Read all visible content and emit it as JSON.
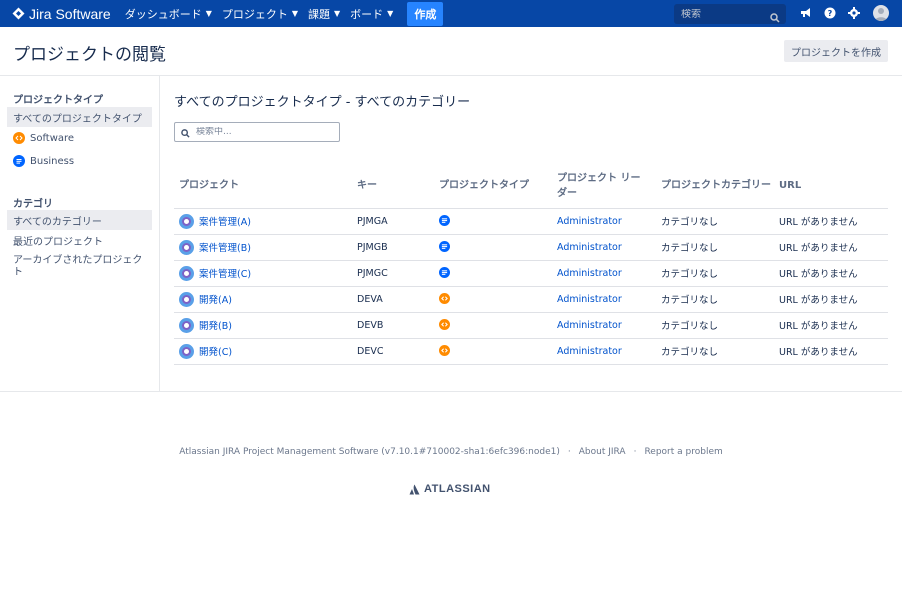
{
  "topnav": {
    "app_name": "Jira Software",
    "menu": [
      {
        "label": "ダッシュボード"
      },
      {
        "label": "プロジェクト"
      },
      {
        "label": "課題"
      },
      {
        "label": "ボード"
      }
    ],
    "create_label": "作成",
    "search_placeholder": "検索",
    "colors": {
      "nav_bg": "#0747a6",
      "create_bg": "#2684ff"
    }
  },
  "page": {
    "title": "プロジェクトの閲覧",
    "create_project_label": "プロジェクトを作成"
  },
  "sidebar": {
    "project_type_heading": "プロジェクトタイプ",
    "project_types": [
      {
        "label": "すべてのプロジェクトタイプ",
        "icon": "none",
        "selected": true
      },
      {
        "label": "Software",
        "icon": "software-icon",
        "selected": false
      },
      {
        "label": "Business",
        "icon": "business-icon",
        "selected": false
      }
    ],
    "category_heading": "カテゴリ",
    "categories": [
      {
        "label": "すべてのカテゴリー",
        "selected": true
      },
      {
        "label": "最近のプロジェクト",
        "selected": false
      },
      {
        "label": "アーカイブされたプロジェクト",
        "selected": false
      }
    ]
  },
  "main": {
    "heading": "すべてのプロジェクトタイプ - すべてのカテゴリー",
    "filter_placeholder": "検索中...",
    "columns": [
      "プロジェクト",
      "キー",
      "プロジェクトタイプ",
      "プロジェクト リーダー",
      "プロジェクトカテゴリー",
      "URL"
    ],
    "rows": [
      {
        "name": "案件管理(A)",
        "key": "PJMGA",
        "type": "business",
        "lead": "Administrator",
        "category": "カテゴリなし",
        "url": "URL がありません"
      },
      {
        "name": "案件管理(B)",
        "key": "PJMGB",
        "type": "business",
        "lead": "Administrator",
        "category": "カテゴリなし",
        "url": "URL がありません"
      },
      {
        "name": "案件管理(C)",
        "key": "PJMGC",
        "type": "business",
        "lead": "Administrator",
        "category": "カテゴリなし",
        "url": "URL がありません"
      },
      {
        "name": "開発(A)",
        "key": "DEVA",
        "type": "software",
        "lead": "Administrator",
        "category": "カテゴリなし",
        "url": "URL がありません"
      },
      {
        "name": "開発(B)",
        "key": "DEVB",
        "type": "software",
        "lead": "Administrator",
        "category": "カテゴリなし",
        "url": "URL がありません"
      },
      {
        "name": "開発(C)",
        "key": "DEVC",
        "type": "software",
        "lead": "Administrator",
        "category": "カテゴリなし",
        "url": "URL がありません"
      }
    ],
    "type_colors": {
      "business": "#0065ff",
      "software": "#ff8b00"
    }
  },
  "footer": {
    "version_text": "Atlassian JIRA Project Management Software (v7.10.1#710002-sha1:6efc396:node1)",
    "about_label": "About JIRA",
    "report_label": "Report a problem",
    "logo_text": "ATLASSIAN"
  }
}
